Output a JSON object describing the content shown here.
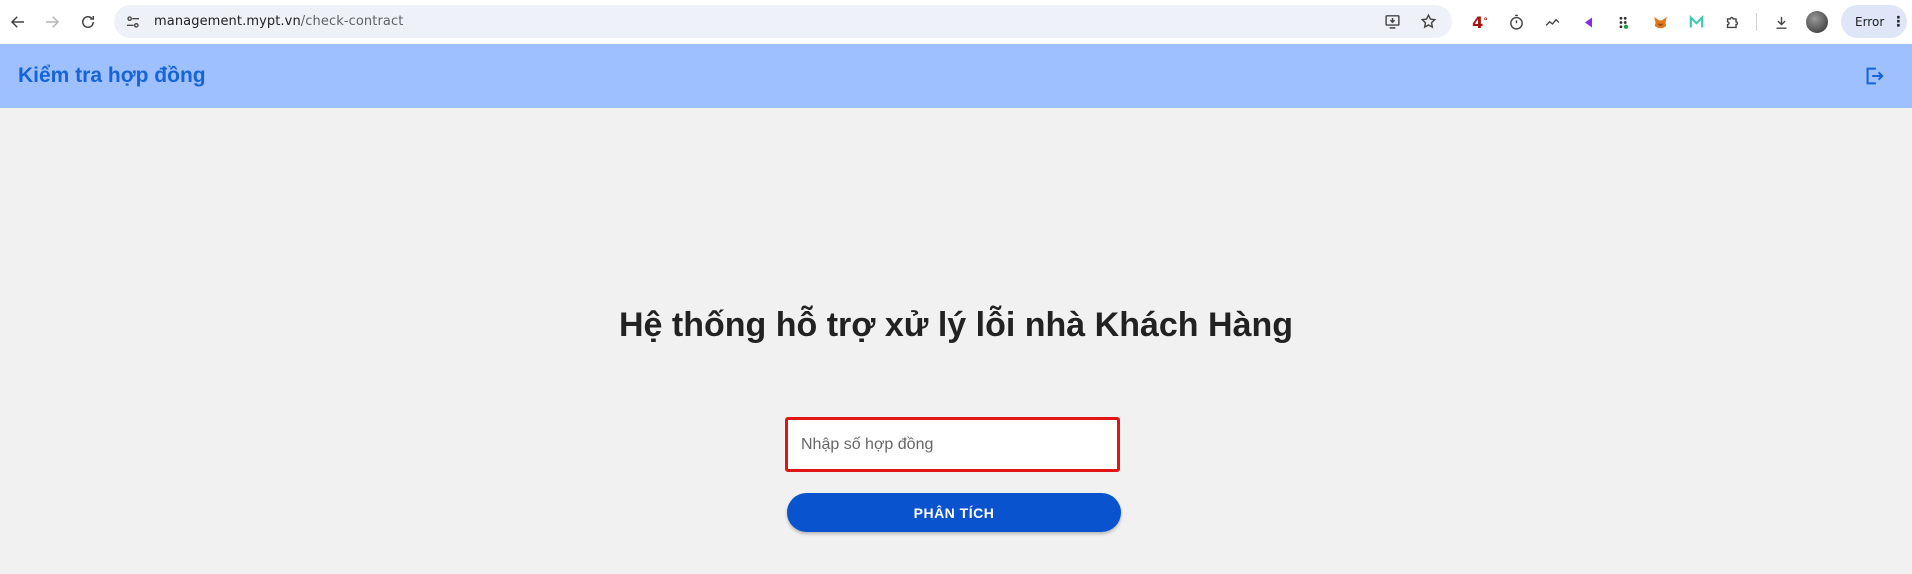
{
  "browser": {
    "url_host": "management.mypt.vn",
    "url_path": "/check-contract",
    "weather_badge": "4",
    "weather_degree": "°",
    "profile_status": "Error",
    "profile_menu": "⋮"
  },
  "header": {
    "title": "Kiểm tra hợp đồng"
  },
  "main": {
    "heading": "Hệ thống hỗ trợ xử lý lỗi nhà Khách Hàng",
    "contract_input": {
      "placeholder": "Nhập số hợp đồng",
      "value": ""
    },
    "analyze_button": "PHÂN TÍCH"
  },
  "colors": {
    "header_bg": "#9ec0fe",
    "accent": "#1565d8",
    "button_bg": "#0a53cf",
    "input_border": "#e01515",
    "page_bg": "#f1f1f1"
  },
  "icons": {
    "back": "arrow-left-icon",
    "forward": "arrow-right-icon",
    "reload": "reload-icon",
    "site_info": "tune-icon",
    "install": "install-app-icon",
    "bookmark": "star-icon",
    "logout": "logout-icon"
  }
}
